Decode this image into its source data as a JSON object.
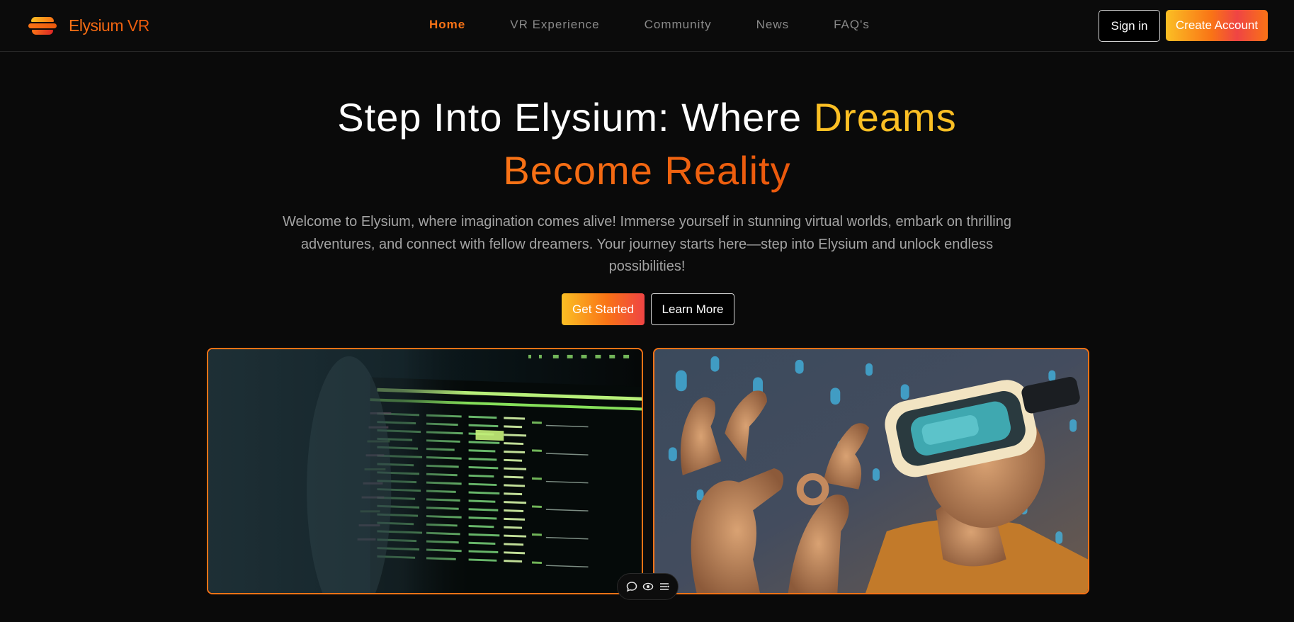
{
  "brand": {
    "name": "Elysium VR"
  },
  "nav": {
    "links": [
      {
        "label": "Home",
        "active": true
      },
      {
        "label": "VR Experience",
        "active": false
      },
      {
        "label": "Community",
        "active": false
      },
      {
        "label": "News",
        "active": false
      },
      {
        "label": "FAQ's",
        "active": false
      }
    ]
  },
  "auth": {
    "signin_label": "Sign in",
    "create_label": "Create Account"
  },
  "hero": {
    "title_part1": "Step Into Elysium: Where ",
    "title_part2": "Dreams",
    "title_part3": "Become Reality",
    "description": "Welcome to Elysium, where imagination comes alive! Immerse yourself in stunning virtual worlds, embark on thrilling adventures, and connect with fellow dreamers. Your journey starts here—step into Elysium and unlock endless possibilities!",
    "cta_primary": "Get Started",
    "cta_secondary": "Learn More"
  },
  "images": {
    "left": {
      "icon": "terminal-screen-photo"
    },
    "right": {
      "icon": "vr-headset-user-photo"
    }
  },
  "toolbar": {
    "icons": [
      "chat-icon",
      "eye-icon",
      "menu-icon"
    ]
  },
  "colors": {
    "accent": "#f97316",
    "accent_yellow": "#fbbf24",
    "accent_red": "#ef4444",
    "background": "#0a0a0a"
  }
}
